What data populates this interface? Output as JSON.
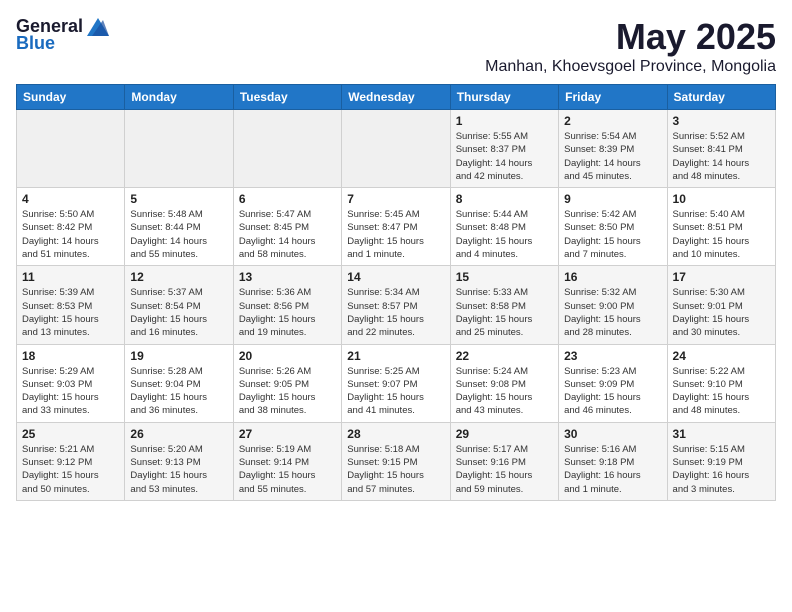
{
  "logo": {
    "general": "General",
    "blue": "Blue"
  },
  "title": {
    "month_year": "May 2025",
    "location": "Manhan, Khoevsgoel Province, Mongolia"
  },
  "headers": [
    "Sunday",
    "Monday",
    "Tuesday",
    "Wednesday",
    "Thursday",
    "Friday",
    "Saturday"
  ],
  "weeks": [
    [
      {
        "day": "",
        "info": ""
      },
      {
        "day": "",
        "info": ""
      },
      {
        "day": "",
        "info": ""
      },
      {
        "day": "",
        "info": ""
      },
      {
        "day": "1",
        "info": "Sunrise: 5:55 AM\nSunset: 8:37 PM\nDaylight: 14 hours\nand 42 minutes."
      },
      {
        "day": "2",
        "info": "Sunrise: 5:54 AM\nSunset: 8:39 PM\nDaylight: 14 hours\nand 45 minutes."
      },
      {
        "day": "3",
        "info": "Sunrise: 5:52 AM\nSunset: 8:41 PM\nDaylight: 14 hours\nand 48 minutes."
      }
    ],
    [
      {
        "day": "4",
        "info": "Sunrise: 5:50 AM\nSunset: 8:42 PM\nDaylight: 14 hours\nand 51 minutes."
      },
      {
        "day": "5",
        "info": "Sunrise: 5:48 AM\nSunset: 8:44 PM\nDaylight: 14 hours\nand 55 minutes."
      },
      {
        "day": "6",
        "info": "Sunrise: 5:47 AM\nSunset: 8:45 PM\nDaylight: 14 hours\nand 58 minutes."
      },
      {
        "day": "7",
        "info": "Sunrise: 5:45 AM\nSunset: 8:47 PM\nDaylight: 15 hours\nand 1 minute."
      },
      {
        "day": "8",
        "info": "Sunrise: 5:44 AM\nSunset: 8:48 PM\nDaylight: 15 hours\nand 4 minutes."
      },
      {
        "day": "9",
        "info": "Sunrise: 5:42 AM\nSunset: 8:50 PM\nDaylight: 15 hours\nand 7 minutes."
      },
      {
        "day": "10",
        "info": "Sunrise: 5:40 AM\nSunset: 8:51 PM\nDaylight: 15 hours\nand 10 minutes."
      }
    ],
    [
      {
        "day": "11",
        "info": "Sunrise: 5:39 AM\nSunset: 8:53 PM\nDaylight: 15 hours\nand 13 minutes."
      },
      {
        "day": "12",
        "info": "Sunrise: 5:37 AM\nSunset: 8:54 PM\nDaylight: 15 hours\nand 16 minutes."
      },
      {
        "day": "13",
        "info": "Sunrise: 5:36 AM\nSunset: 8:56 PM\nDaylight: 15 hours\nand 19 minutes."
      },
      {
        "day": "14",
        "info": "Sunrise: 5:34 AM\nSunset: 8:57 PM\nDaylight: 15 hours\nand 22 minutes."
      },
      {
        "day": "15",
        "info": "Sunrise: 5:33 AM\nSunset: 8:58 PM\nDaylight: 15 hours\nand 25 minutes."
      },
      {
        "day": "16",
        "info": "Sunrise: 5:32 AM\nSunset: 9:00 PM\nDaylight: 15 hours\nand 28 minutes."
      },
      {
        "day": "17",
        "info": "Sunrise: 5:30 AM\nSunset: 9:01 PM\nDaylight: 15 hours\nand 30 minutes."
      }
    ],
    [
      {
        "day": "18",
        "info": "Sunrise: 5:29 AM\nSunset: 9:03 PM\nDaylight: 15 hours\nand 33 minutes."
      },
      {
        "day": "19",
        "info": "Sunrise: 5:28 AM\nSunset: 9:04 PM\nDaylight: 15 hours\nand 36 minutes."
      },
      {
        "day": "20",
        "info": "Sunrise: 5:26 AM\nSunset: 9:05 PM\nDaylight: 15 hours\nand 38 minutes."
      },
      {
        "day": "21",
        "info": "Sunrise: 5:25 AM\nSunset: 9:07 PM\nDaylight: 15 hours\nand 41 minutes."
      },
      {
        "day": "22",
        "info": "Sunrise: 5:24 AM\nSunset: 9:08 PM\nDaylight: 15 hours\nand 43 minutes."
      },
      {
        "day": "23",
        "info": "Sunrise: 5:23 AM\nSunset: 9:09 PM\nDaylight: 15 hours\nand 46 minutes."
      },
      {
        "day": "24",
        "info": "Sunrise: 5:22 AM\nSunset: 9:10 PM\nDaylight: 15 hours\nand 48 minutes."
      }
    ],
    [
      {
        "day": "25",
        "info": "Sunrise: 5:21 AM\nSunset: 9:12 PM\nDaylight: 15 hours\nand 50 minutes."
      },
      {
        "day": "26",
        "info": "Sunrise: 5:20 AM\nSunset: 9:13 PM\nDaylight: 15 hours\nand 53 minutes."
      },
      {
        "day": "27",
        "info": "Sunrise: 5:19 AM\nSunset: 9:14 PM\nDaylight: 15 hours\nand 55 minutes."
      },
      {
        "day": "28",
        "info": "Sunrise: 5:18 AM\nSunset: 9:15 PM\nDaylight: 15 hours\nand 57 minutes."
      },
      {
        "day": "29",
        "info": "Sunrise: 5:17 AM\nSunset: 9:16 PM\nDaylight: 15 hours\nand 59 minutes."
      },
      {
        "day": "30",
        "info": "Sunrise: 5:16 AM\nSunset: 9:18 PM\nDaylight: 16 hours\nand 1 minute."
      },
      {
        "day": "31",
        "info": "Sunrise: 5:15 AM\nSunset: 9:19 PM\nDaylight: 16 hours\nand 3 minutes."
      }
    ]
  ]
}
